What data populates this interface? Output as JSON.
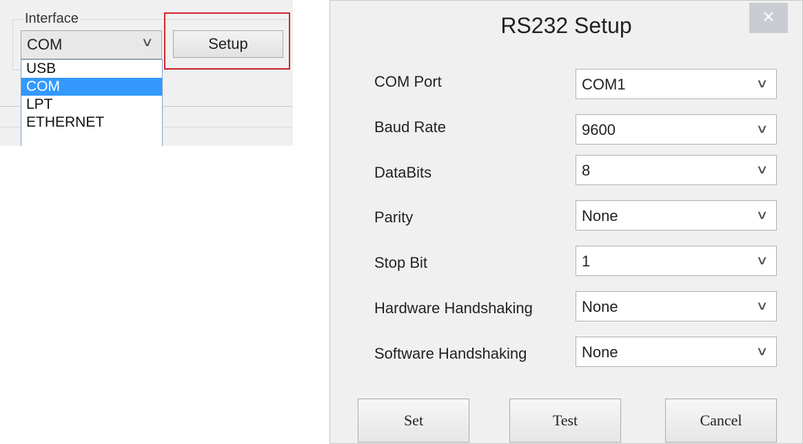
{
  "interface_panel": {
    "label": "Interface",
    "selected": "COM",
    "setup_label": "Setup",
    "options": [
      "USB",
      "COM",
      "LPT",
      "ETHERNET"
    ],
    "highlight_color": "#d2232a"
  },
  "dialog": {
    "title": "RS232 Setup",
    "close_glyph": "×",
    "fields": [
      {
        "label": "COM Port",
        "value": "COM1"
      },
      {
        "label": "Baud Rate",
        "value": "9600"
      },
      {
        "label": "DataBits",
        "value": "8"
      },
      {
        "label": "Parity",
        "value": "None"
      },
      {
        "label": "Stop Bit",
        "value": "1"
      },
      {
        "label": "Hardware Handshaking",
        "value": "None"
      },
      {
        "label": "Software Handshaking",
        "value": "None"
      }
    ],
    "buttons": {
      "set": "Set",
      "test": "Test",
      "cancel": "Cancel"
    }
  }
}
